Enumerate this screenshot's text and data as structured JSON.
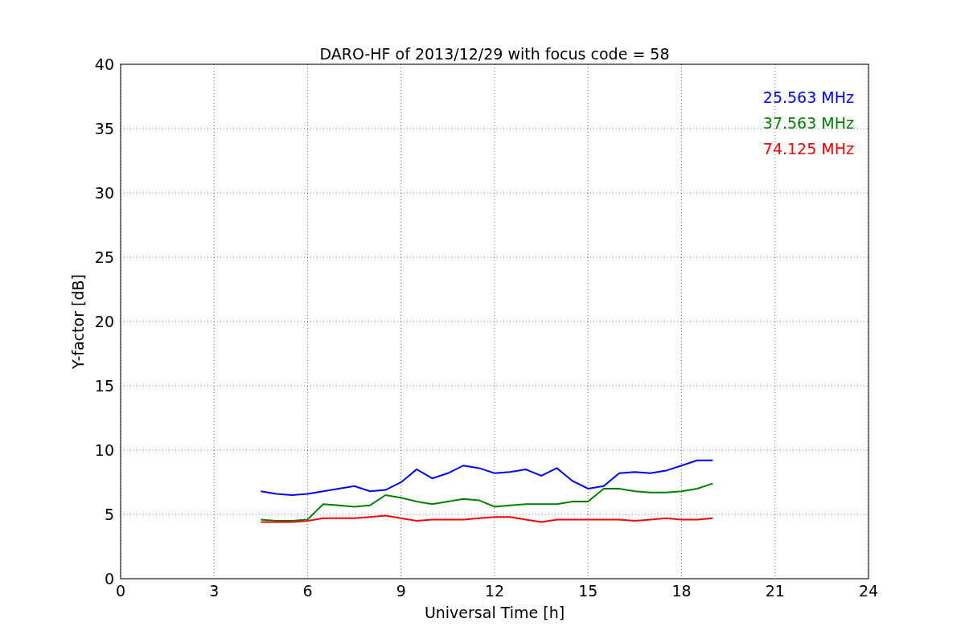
{
  "figure": {
    "chart_data": {
      "type": "line",
      "title": "DARO-HF of 2013/12/29 with focus code = 58",
      "xlabel": "Universal Time [h]",
      "ylabel": "Y-factor [dB]",
      "x": [
        4.5,
        5,
        5.5,
        6,
        6.5,
        7,
        7.5,
        8,
        8.5,
        9,
        9.5,
        10,
        10.5,
        11,
        11.5,
        12,
        12.5,
        13,
        13.5,
        14,
        14.5,
        15,
        15.5,
        16,
        16.5,
        17,
        17.5,
        18,
        18.5,
        19
      ],
      "series": [
        {
          "name": "25.563 MHz",
          "color": "#0000ff",
          "values": [
            6.8,
            6.6,
            6.5,
            6.6,
            6.8,
            7.0,
            7.2,
            6.8,
            6.9,
            7.5,
            8.5,
            7.8,
            8.2,
            8.8,
            8.6,
            8.2,
            8.3,
            8.5,
            8.0,
            8.6,
            7.6,
            7.0,
            7.2,
            8.2,
            8.3,
            8.2,
            8.4,
            8.8,
            9.2,
            9.2
          ]
        },
        {
          "name": "37.563 MHz",
          "color": "#008000",
          "values": [
            4.6,
            4.5,
            4.5,
            4.6,
            5.8,
            5.7,
            5.6,
            5.7,
            6.5,
            6.3,
            6.0,
            5.8,
            6.0,
            6.2,
            6.1,
            5.6,
            5.7,
            5.8,
            5.8,
            5.8,
            6.0,
            6.0,
            7.0,
            7.0,
            6.8,
            6.7,
            6.7,
            6.8,
            7.0,
            7.4
          ]
        },
        {
          "name": "74.125 MHz",
          "color": "#ff0000",
          "values": [
            4.4,
            4.4,
            4.4,
            4.5,
            4.7,
            4.7,
            4.7,
            4.8,
            4.9,
            4.7,
            4.5,
            4.6,
            4.6,
            4.6,
            4.7,
            4.8,
            4.8,
            4.6,
            4.4,
            4.6,
            4.6,
            4.6,
            4.6,
            4.6,
            4.5,
            4.6,
            4.7,
            4.6,
            4.6,
            4.7
          ]
        }
      ],
      "grid": true,
      "xlim": [
        0,
        24
      ],
      "ylim": [
        0,
        40
      ],
      "xticks": [
        0,
        3,
        6,
        9,
        12,
        15,
        18,
        21,
        24
      ],
      "yticks": [
        0,
        5,
        10,
        15,
        20,
        25,
        30,
        35,
        40
      ]
    }
  }
}
